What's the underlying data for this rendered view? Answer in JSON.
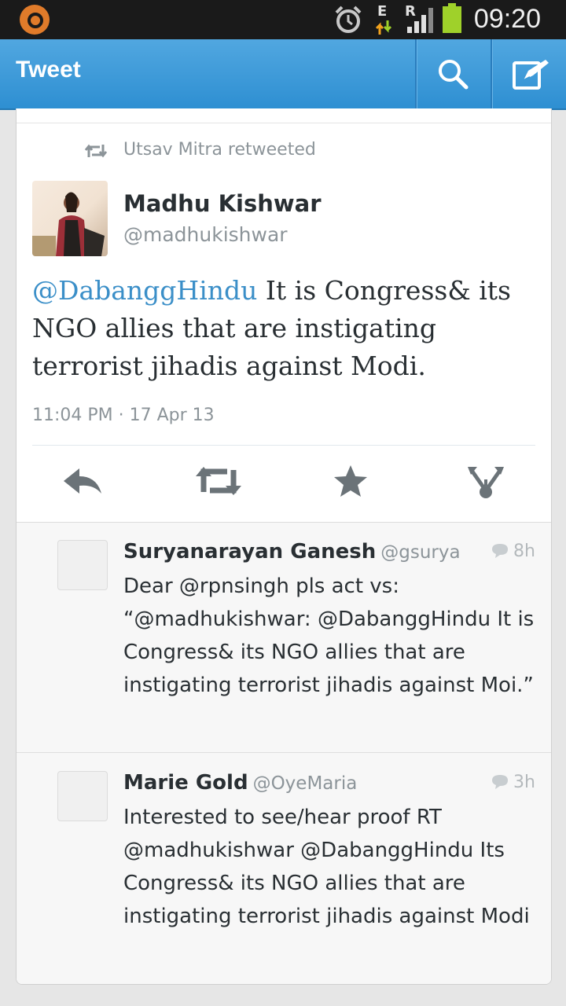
{
  "status_bar": {
    "time": "09:20",
    "network_letters": [
      "E",
      "R"
    ],
    "icons": [
      "app-launcher-icon",
      "alarm-icon",
      "data-arrows-icon",
      "signal-icon",
      "battery-icon"
    ]
  },
  "action_bar": {
    "title": "Tweet",
    "icons": [
      "search-icon",
      "compose-icon"
    ],
    "color": "#3a99d8"
  },
  "tweet": {
    "retweeted_by": "Utsav Mitra retweeted",
    "author_name": "Madhu Kishwar",
    "author_handle": "@madhukishwar",
    "mention": "@DabanggHindu",
    "text": " It is Congress& its NGO allies that are instigating terrorist jihadis against Modi.",
    "timestamp": "11:04 PM · 17 Apr 13",
    "mention_color": "#3b8fc8",
    "actions": [
      "reply-icon",
      "retweet-icon",
      "favorite-icon",
      "share-icon"
    ]
  },
  "replies": [
    {
      "name": "Suryanarayan Ganesh",
      "handle": "@gsurya",
      "time": "8h",
      "text": "Dear @rpnsingh pls act vs: “@madhukishwar: @DabanggHindu It is Congress& its NGO allies that are instigating terrorist jihadis against Moi.”"
    },
    {
      "name": "Marie Gold",
      "handle": "@OyeMaria",
      "time": "3h",
      "text": "Interested to see/hear proof RT @madhukishwar @DabanggHindu Its Congress& its NGO allies that are instigating terrorist jihadis against Modi"
    }
  ]
}
